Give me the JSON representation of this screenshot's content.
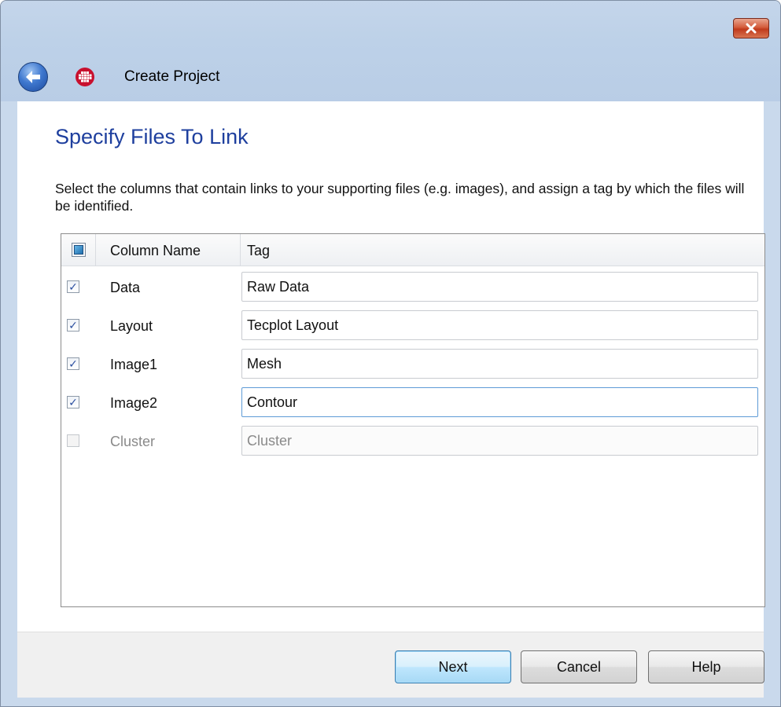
{
  "window": {
    "title": "Create Project"
  },
  "page": {
    "heading": "Specify Files To Link",
    "instructions": "Select the columns that contain links to your supporting files (e.g. images), and assign a tag by which the files will be identified."
  },
  "grid": {
    "headers": {
      "column_name": "Column Name",
      "tag": "Tag"
    },
    "rows": [
      {
        "name": "Data",
        "tag": "Raw Data",
        "checked": true,
        "enabled": true
      },
      {
        "name": "Layout",
        "tag": "Tecplot Layout",
        "checked": true,
        "enabled": true
      },
      {
        "name": "Image1",
        "tag": "Mesh",
        "checked": true,
        "enabled": true
      },
      {
        "name": "Image2",
        "tag": "Contour",
        "checked": true,
        "enabled": true,
        "focused": true
      },
      {
        "name": "Cluster",
        "tag": "Cluster",
        "checked": false,
        "enabled": false
      }
    ]
  },
  "buttons": {
    "next": "Next",
    "cancel": "Cancel",
    "help": "Help"
  },
  "icons": {
    "close": "close-icon",
    "back": "back-arrow-icon",
    "app": "tecplot-app-icon",
    "checkmark": "checkmark-icon"
  },
  "colors": {
    "heading": "#1e3f9e",
    "titlebar": "#bdd1e8",
    "close_button": "#c9462a",
    "default_button_border": "#3c7fb1",
    "app_icon": "#c8102e"
  }
}
